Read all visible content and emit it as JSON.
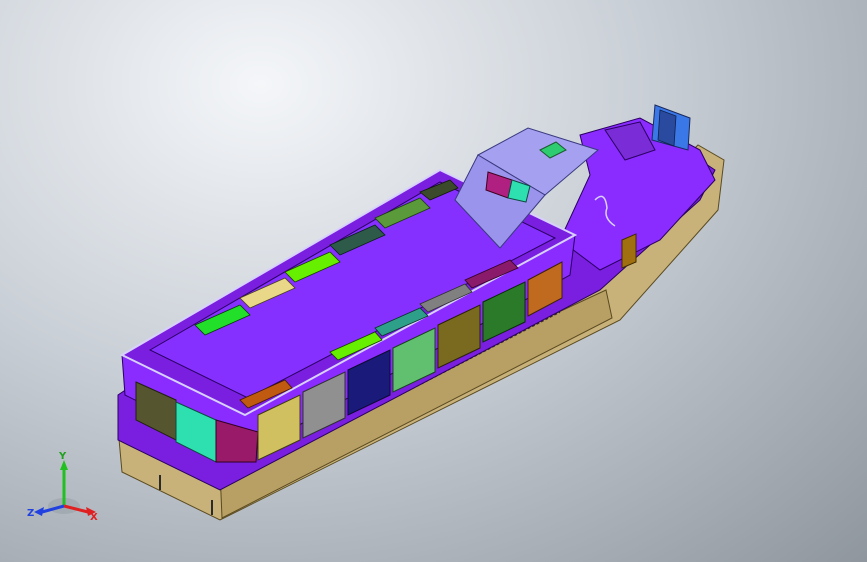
{
  "viewport": {
    "background_top": "#f4f6f9",
    "background_bottom": "#8f969e"
  },
  "colors": {
    "hull_tan": "#c8b27a",
    "deck_purple": "#7a1fe0",
    "upper_purple": "#8a2bff",
    "cabin_lavender": "#a6a0f0",
    "panel_green_bright": "#22e02a",
    "panel_teal": "#2ee0b0"
  },
  "triad": {
    "x_label": "X",
    "y_label": "Y",
    "z_label": "Z",
    "x_color": "#e02020",
    "y_color": "#20c020",
    "z_color": "#2040e0"
  }
}
